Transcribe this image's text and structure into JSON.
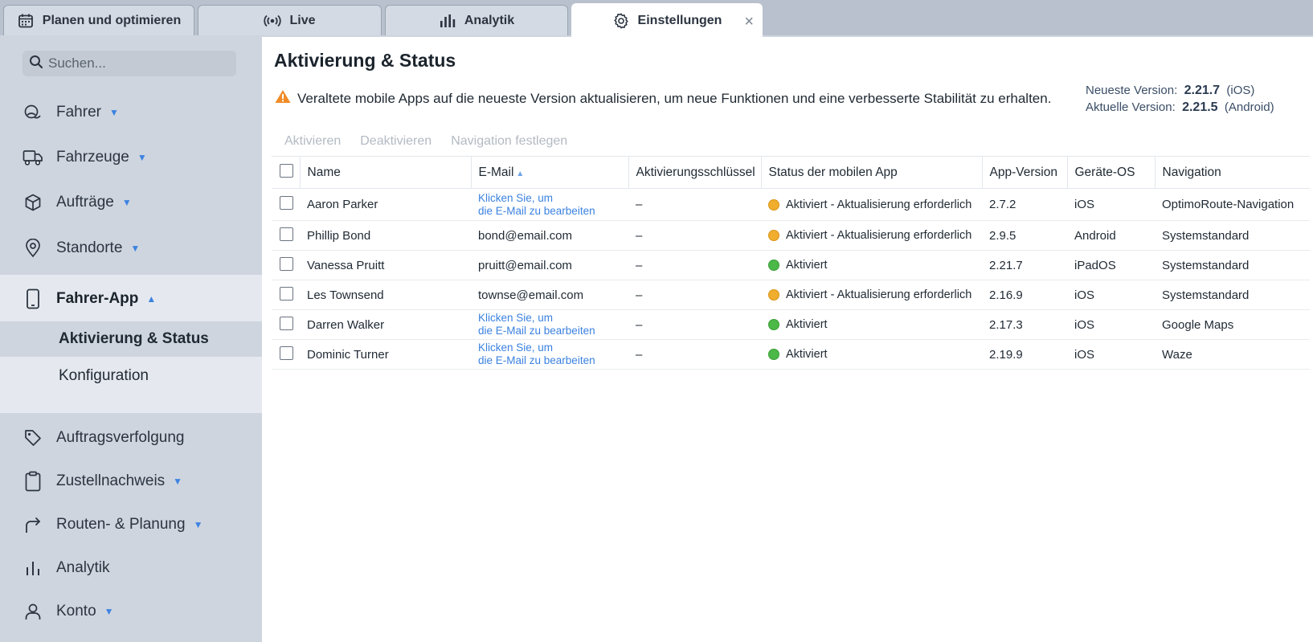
{
  "tabs": [
    {
      "label": "Planen und optimieren",
      "icon": "calendar-icon"
    },
    {
      "label": "Live",
      "icon": "broadcast-icon"
    },
    {
      "label": "Analytik",
      "icon": "bar-chart-icon"
    },
    {
      "label": "Einstellungen",
      "icon": "gear-icon",
      "active": true,
      "close": "×"
    }
  ],
  "sidebar": {
    "search_placeholder": "Suchen...",
    "items": [
      {
        "label": "Fahrer",
        "icon": "driver-icon"
      },
      {
        "label": "Fahrzeuge",
        "icon": "truck-icon"
      },
      {
        "label": "Aufträge",
        "icon": "box-icon"
      },
      {
        "label": "Standorte",
        "icon": "location-pin-icon"
      },
      {
        "label": "Fahrer-App",
        "icon": "smartphone-icon"
      },
      {
        "label": "Auftragsverfolgung",
        "icon": "tag-icon"
      },
      {
        "label": "Zustellnachweis",
        "icon": "clipboard-icon"
      },
      {
        "label": "Routen- & Planung",
        "icon": "route-arrow-icon"
      },
      {
        "label": "Analytik",
        "icon": "bar-chart-icon"
      },
      {
        "label": "Konto",
        "icon": "user-icon"
      }
    ],
    "sub_items": [
      {
        "label": "Aktivierung & Status",
        "active": true
      },
      {
        "label": "Konfiguration"
      }
    ]
  },
  "main": {
    "title": "Aktivierung & Status",
    "warning": "Veraltete mobile Apps auf die neueste Version aktualisieren, um neue Funktionen und eine verbesserte Stabilität zu erhalten.",
    "version": {
      "latest_label": "Neueste Version:",
      "latest_value": "2.21.7",
      "latest_platform": "(iOS)",
      "current_label": "Aktuelle Version:",
      "current_value": "2.21.5",
      "current_platform": "(Android)"
    },
    "actions": [
      "Aktivieren",
      "Deaktivieren",
      "Navigation festlegen"
    ],
    "columns": [
      "Name",
      "E-Mail",
      "Aktivierungsschlüssel",
      "Status der mobilen App",
      "App-Version",
      "Geräte-OS",
      "Navigation"
    ],
    "email_link_line1": "Klicken Sie, um",
    "email_link_line2": "die E-Mail zu bearbeiten",
    "rows": [
      {
        "name": "Aaron Parker",
        "email": "",
        "key": "–",
        "status": "Aktiviert - Aktualisierung erforderlich",
        "status_color": "#f0ad2e",
        "version": "2.7.2",
        "os": "iOS",
        "nav": "OptimoRoute-Navigation"
      },
      {
        "name": "Phillip Bond",
        "email": "bond@email.com",
        "key": "–",
        "status": "Aktiviert - Aktualisierung erforderlich",
        "status_color": "#f0ad2e",
        "version": "2.9.5",
        "os": "Android",
        "nav": "Systemstandard"
      },
      {
        "name": "Vanessa Pruitt",
        "email": "pruitt@email.com",
        "key": "–",
        "status": "Aktiviert",
        "status_color": "#4cb847",
        "version": "2.21.7",
        "os": "iPadOS",
        "nav": "Systemstandard"
      },
      {
        "name": "Les Townsend",
        "email": "townse@email.com",
        "key": "–",
        "status": "Aktiviert - Aktualisierung erforderlich",
        "status_color": "#f0ad2e",
        "version": "2.16.9",
        "os": "iOS",
        "nav": "Systemstandard"
      },
      {
        "name": "Darren Walker",
        "email": "",
        "key": "–",
        "status": "Aktiviert",
        "status_color": "#4cb847",
        "version": "2.17.3",
        "os": "iOS",
        "nav": "Google Maps"
      },
      {
        "name": "Dominic Turner",
        "email": "",
        "key": "–",
        "status": "Aktiviert",
        "status_color": "#4cb847",
        "version": "2.19.9",
        "os": "iOS",
        "nav": "Waze"
      }
    ]
  }
}
